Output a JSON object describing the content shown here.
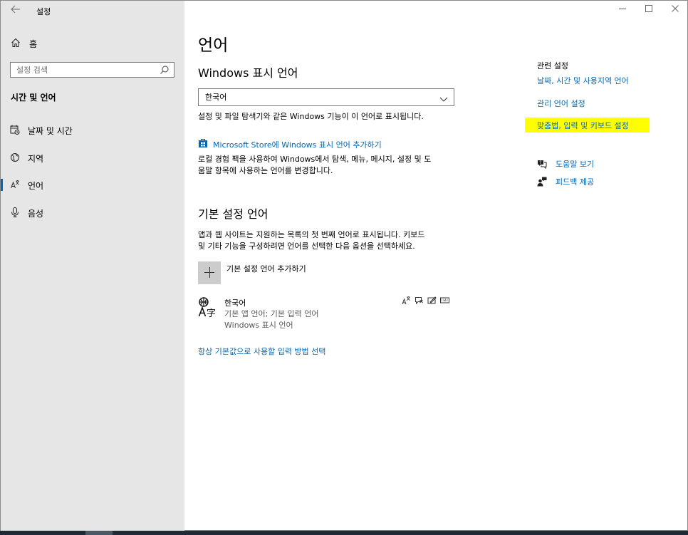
{
  "app": {
    "title": "설정",
    "back_icon": "back-arrow-icon"
  },
  "window_controls": {
    "minimize": "—",
    "maximize": "☐",
    "close": "✕"
  },
  "sidebar": {
    "home_label": "홈",
    "search_placeholder": "설정 검색",
    "section_title": "시간 및 언어",
    "items": [
      {
        "label": "날짜 및 시간",
        "icon": "calendar-clock-icon",
        "active": false
      },
      {
        "label": "지역",
        "icon": "globe-region-icon",
        "active": false
      },
      {
        "label": "언어",
        "icon": "language-icon",
        "active": true
      },
      {
        "label": "음성",
        "icon": "microphone-icon",
        "active": false
      }
    ]
  },
  "main": {
    "page_title": "언어",
    "display_language": {
      "heading": "Windows 표시 언어",
      "selected": "한국어",
      "description": "설정 및 파일 탐색기와 같은 Windows 기능이 이 언어로 표시됩니다.",
      "store_link": "Microsoft Store에 Windows 표시 언어 추가하기",
      "local_experience_line1": "로컬 경험 팩을 사용하여 Windows에서 탐색, 메뉴, 메시지, 설정 및 도",
      "local_experience_line2": "움말 항목에 사용하는 언어를 변경합니다."
    },
    "preferred_languages": {
      "heading": "기본 설정 언어",
      "description_line1": "앱과 웹 사이트는 지원하는 목록의 첫 번째 언어로 표시됩니다. 키보드",
      "description_line2": "및 기타 기능을 구성하려면 언어를 선택한 다음 옵션을 선택하세요.",
      "add_label": "기본 설정 언어 추가하기",
      "languages": [
        {
          "name": "한국어",
          "detail1": "기본 앱 언어; 기본 입력 언어",
          "detail2": "Windows 표시 언어"
        }
      ],
      "default_input_link": "항상 기본값으로 사용할 입력 방법 선택"
    }
  },
  "related": {
    "title": "관련 설정",
    "links": [
      "날짜, 시간 및 사용지역 언어",
      "관리 언어 설정",
      "맞춤법, 입력 및 키보드 설정"
    ],
    "help": "도움말 보기",
    "feedback": "피드백 제공"
  },
  "colors": {
    "accent": "#0067b8",
    "highlight": "#ffff00",
    "sidebar_bg": "#e6e6e6"
  }
}
